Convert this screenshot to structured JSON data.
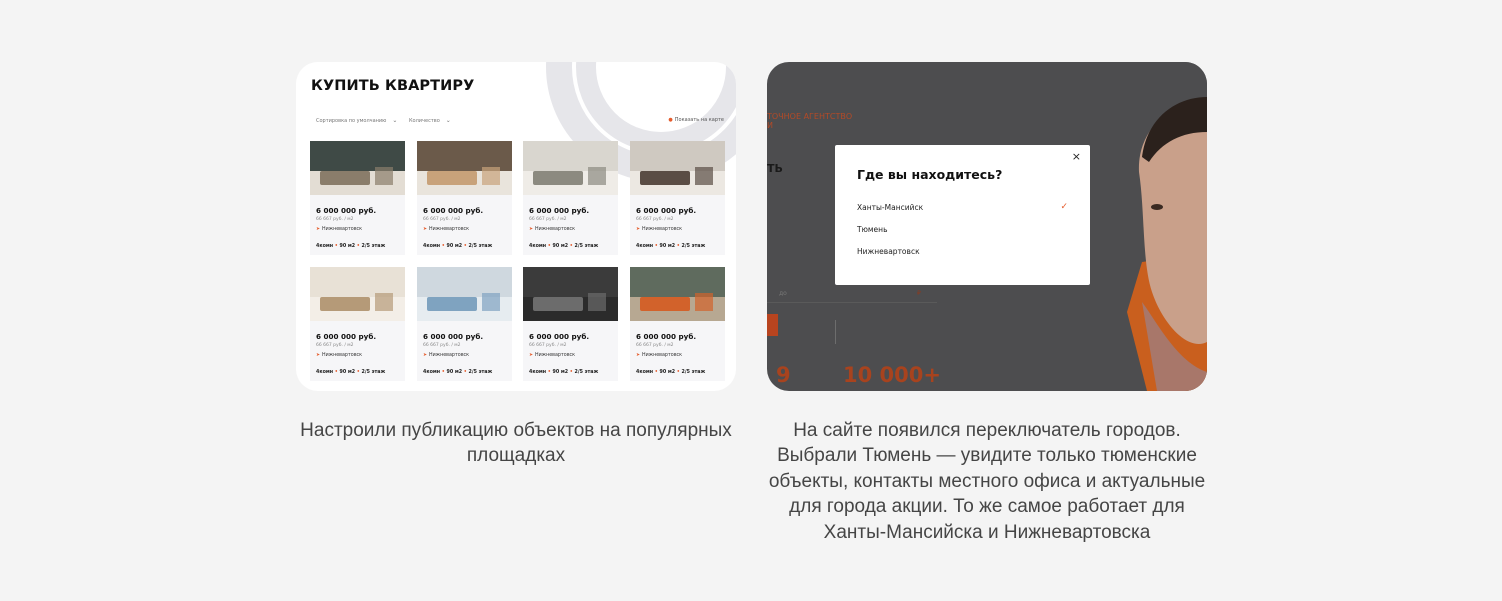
{
  "card1": {
    "title": "КУПИТЬ КВАРТИРУ",
    "filters": {
      "sort": "Сортировка по умолчанию",
      "quantity": "Количество",
      "map": "Показать на карте"
    },
    "listings": [
      {
        "price": "6 000 000 руб.",
        "per_m2": "66 667 руб. / м2",
        "city": "Нижневартовск",
        "specs": [
          "4комн",
          "90 м2",
          "2/5 этаж"
        ]
      },
      {
        "price": "6 000 000 руб.",
        "per_m2": "66 667 руб. / м2",
        "city": "Нижневартовск",
        "specs": [
          "4комн",
          "90 м2",
          "2/5 этаж"
        ]
      },
      {
        "price": "6 000 000 руб.",
        "per_m2": "66 667 руб. / м2",
        "city": "Нижневартовск",
        "specs": [
          "4комн",
          "90 м2",
          "2/5 этаж"
        ]
      },
      {
        "price": "6 000 000 руб.",
        "per_m2": "66 667 руб. / м2",
        "city": "Нижневартовск",
        "specs": [
          "4комн",
          "90 м2",
          "2/5 этаж"
        ]
      },
      {
        "price": "6 000 000 руб.",
        "per_m2": "66 667 руб. / м2",
        "city": "Нижневартовск",
        "specs": [
          "4комн",
          "90 м2",
          "2/5 этаж"
        ]
      },
      {
        "price": "6 000 000 руб.",
        "per_m2": "66 667 руб. / м2",
        "city": "Нижневартовск",
        "specs": [
          "4комн",
          "90 м2",
          "2/5 этаж"
        ]
      },
      {
        "price": "6 000 000 руб.",
        "per_m2": "66 667 руб. / м2",
        "city": "Нижневартовск",
        "specs": [
          "4комн",
          "90 м2",
          "2/5 этаж"
        ]
      },
      {
        "price": "6 000 000 руб.",
        "per_m2": "66 667 руб. / м2",
        "city": "Нижневартовск",
        "specs": [
          "4комн",
          "90 м2",
          "2/5 этаж"
        ]
      }
    ]
  },
  "card2": {
    "background": {
      "agency_line1": "ТОЧНОЕ АГЕНТСТВО",
      "agency_line2": "И",
      "heading_fragment": "ТЬ",
      "field_placeholder": "до",
      "field_unit": "₽",
      "stat1": "9",
      "stat2": "10 000+"
    },
    "modal": {
      "title": "Где вы находитесь?",
      "close": "×",
      "options": [
        {
          "label": "Ханты-Мансийск",
          "selected": true
        },
        {
          "label": "Тюмень",
          "selected": false
        },
        {
          "label": "Нижневартовск",
          "selected": false
        }
      ],
      "check": "✓"
    }
  },
  "captions": {
    "left": "Настроили публикацию объектов на популярных площадках",
    "right": "На сайте появился переключатель городов. Выбрали Тюмень — увидите только тюменские объекты, контакты местного офиса и актуальные для города акции. То же самое работает для Ханты-Мансийска и Нижневартовска"
  },
  "colors": {
    "accent": "#e45c2d",
    "stat": "#a8431e",
    "caption": "#454545",
    "page_bg": "#f4f4f4"
  },
  "icons": {
    "pin": "location-pin-icon",
    "chevron": "chevron-down-icon",
    "check": "check-icon",
    "close": "close-icon"
  }
}
